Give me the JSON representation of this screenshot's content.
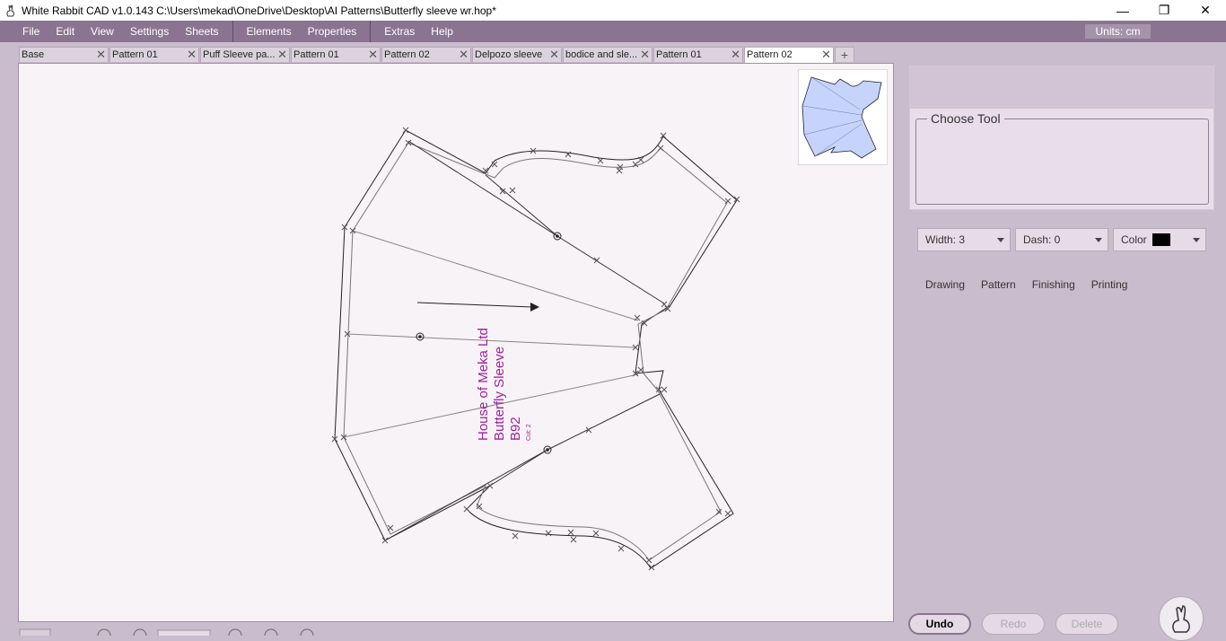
{
  "window": {
    "title": "White Rabbit CAD v1.0.143   C:\\Users\\mekad\\OneDrive\\Desktop\\AI Patterns\\Butterfly sleeve wr.hop*",
    "minimize": "—",
    "maximize": "❐",
    "close": "✕"
  },
  "menu": {
    "file": "File",
    "edit": "Edit",
    "view": "View",
    "settings": "Settings",
    "sheets": "Sheets",
    "elements": "Elements",
    "properties": "Properties",
    "extras": "Extras",
    "help": "Help",
    "units": "Units:  cm"
  },
  "tabs": [
    {
      "label": "Base"
    },
    {
      "label": "Pattern 01"
    },
    {
      "label": "Puff Sleeve pa..."
    },
    {
      "label": "Pattern 01"
    },
    {
      "label": "Pattern 02"
    },
    {
      "label": "Delpozo sleeve"
    },
    {
      "label": "bodice and sle..."
    },
    {
      "label": "Pattern 01"
    },
    {
      "label": "Pattern 02"
    }
  ],
  "tab_close_glyph": "✕",
  "tab_add_glyph": "+",
  "pattern_text": {
    "company": "House of Meka Ltd",
    "name": "Butterfly Sleeve",
    "code": "B92",
    "cut": "Cut: 2",
    "color": "#a020a0"
  },
  "panel": {
    "choose_tool": "Choose Tool",
    "width": "Width:  3",
    "dash": "Dash:  0",
    "color_label": "Color",
    "color_value": "#000000"
  },
  "modes": [
    "Drawing",
    "Pattern",
    "Finishing",
    "Printing"
  ],
  "actions": {
    "undo": "Undo",
    "redo": "Redo",
    "delete": "Delete"
  },
  "colors": {
    "menubar": "#8a7491",
    "background": "#c9bccc",
    "canvas": "#f8f3f6",
    "thumb_fill": "#c6d4fb"
  }
}
